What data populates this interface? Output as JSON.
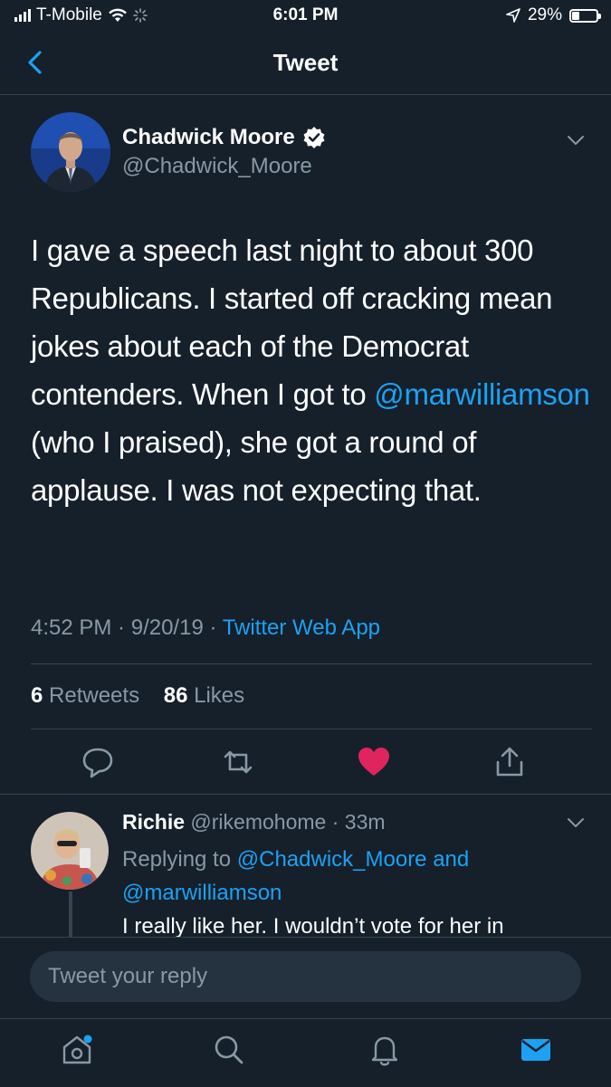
{
  "status_bar": {
    "carrier": "T-Mobile",
    "time": "6:01 PM",
    "battery": "29%",
    "battery_level": 0.29
  },
  "nav": {
    "title": "Tweet"
  },
  "tweet": {
    "author_name": "Chadwick Moore",
    "author_handle": "@Chadwick_Moore",
    "text_part1": "I gave a speech last night to about 300 Republicans. I started off cracking mean jokes about each of the Democrat contenders. When I got to ",
    "mention": "@marwilliamson",
    "text_part2": " (who I praised), she got a round of applause. I was not expecting that.",
    "time": "4:52 PM",
    "date": "9/20/19",
    "source": "Twitter Web App",
    "retweets_count": "6",
    "retweets_label": "Retweets",
    "likes_count": "86",
    "likes_label": "Likes",
    "liked": true,
    "like_color": "#e0245e",
    "accent_color": "#1da1f2"
  },
  "reply": {
    "name": "Richie",
    "handle": "@rikemohome",
    "age": "33m",
    "replying_to_label": "Replying to",
    "replying_to_user1": "@Chadwick_Moore",
    "and": "and",
    "replying_to_user2": "@marwilliamson",
    "text_preview": "I really like her. I wouldn’t vote for her in"
  },
  "composer": {
    "placeholder": "Tweet your reply"
  },
  "tabs": [
    "home-icon",
    "search-icon",
    "notifications-icon",
    "messages-icon"
  ]
}
